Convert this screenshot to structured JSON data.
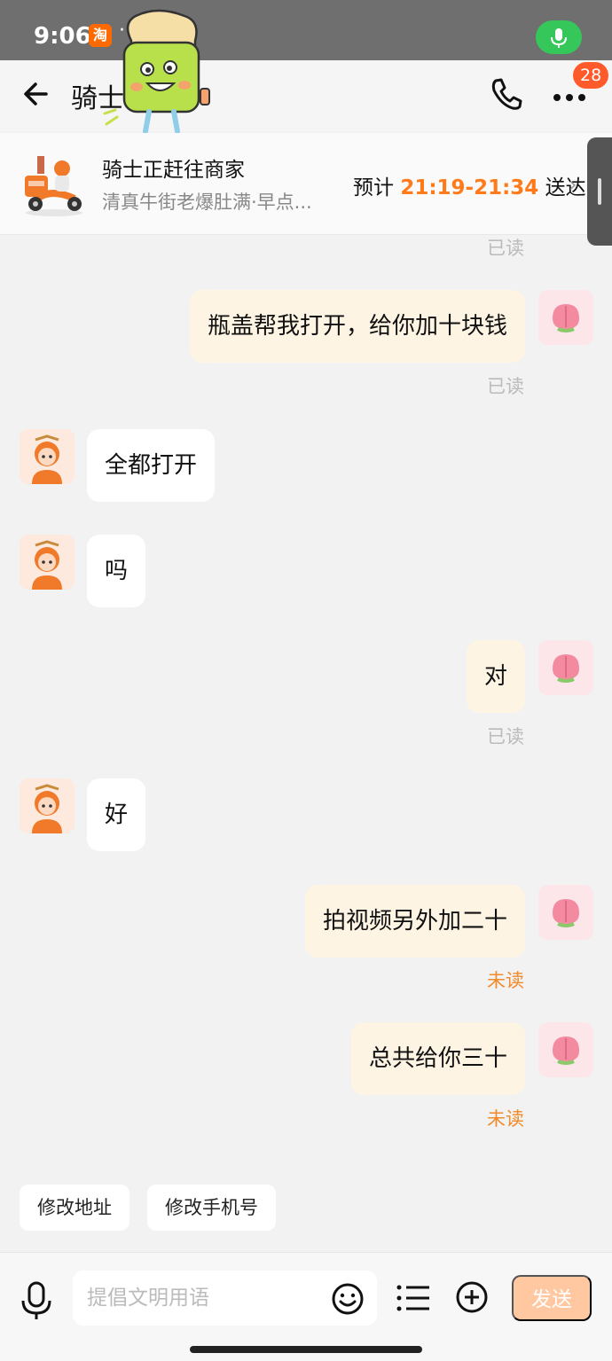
{
  "status_bar": {
    "time": "9:06",
    "app_glyph": "淘",
    "dots": "··"
  },
  "header": {
    "title": "骑士",
    "badge_count": "28"
  },
  "order": {
    "status": "骑士正赶往商家",
    "shop": "清真牛街老爆肚满·早点...",
    "eta_prefix": "预计",
    "eta_time": "21:19-21:34",
    "eta_suffix": "送达"
  },
  "chat": {
    "top_read": "已读",
    "messages": [
      {
        "from": "me",
        "text": "瓶盖帮我打开，给你加十块钱",
        "status": "已读"
      },
      {
        "from": "rider",
        "text": "全都打开"
      },
      {
        "from": "rider",
        "text": "吗"
      },
      {
        "from": "me",
        "text": "对",
        "status": "已读"
      },
      {
        "from": "rider",
        "text": "好"
      },
      {
        "from": "me",
        "text": "拍视频另外加二十",
        "status": "未读"
      },
      {
        "from": "me",
        "text": "总共给你三十",
        "status": "未读"
      }
    ]
  },
  "quick_replies": [
    "修改地址",
    "修改手机号"
  ],
  "input": {
    "placeholder": "提倡文明用语",
    "send_label": "发送"
  },
  "colors": {
    "accent": "#ff7a1a",
    "bubble_me": "#fdf4e4",
    "send_disabled": "#ffc8a0"
  }
}
